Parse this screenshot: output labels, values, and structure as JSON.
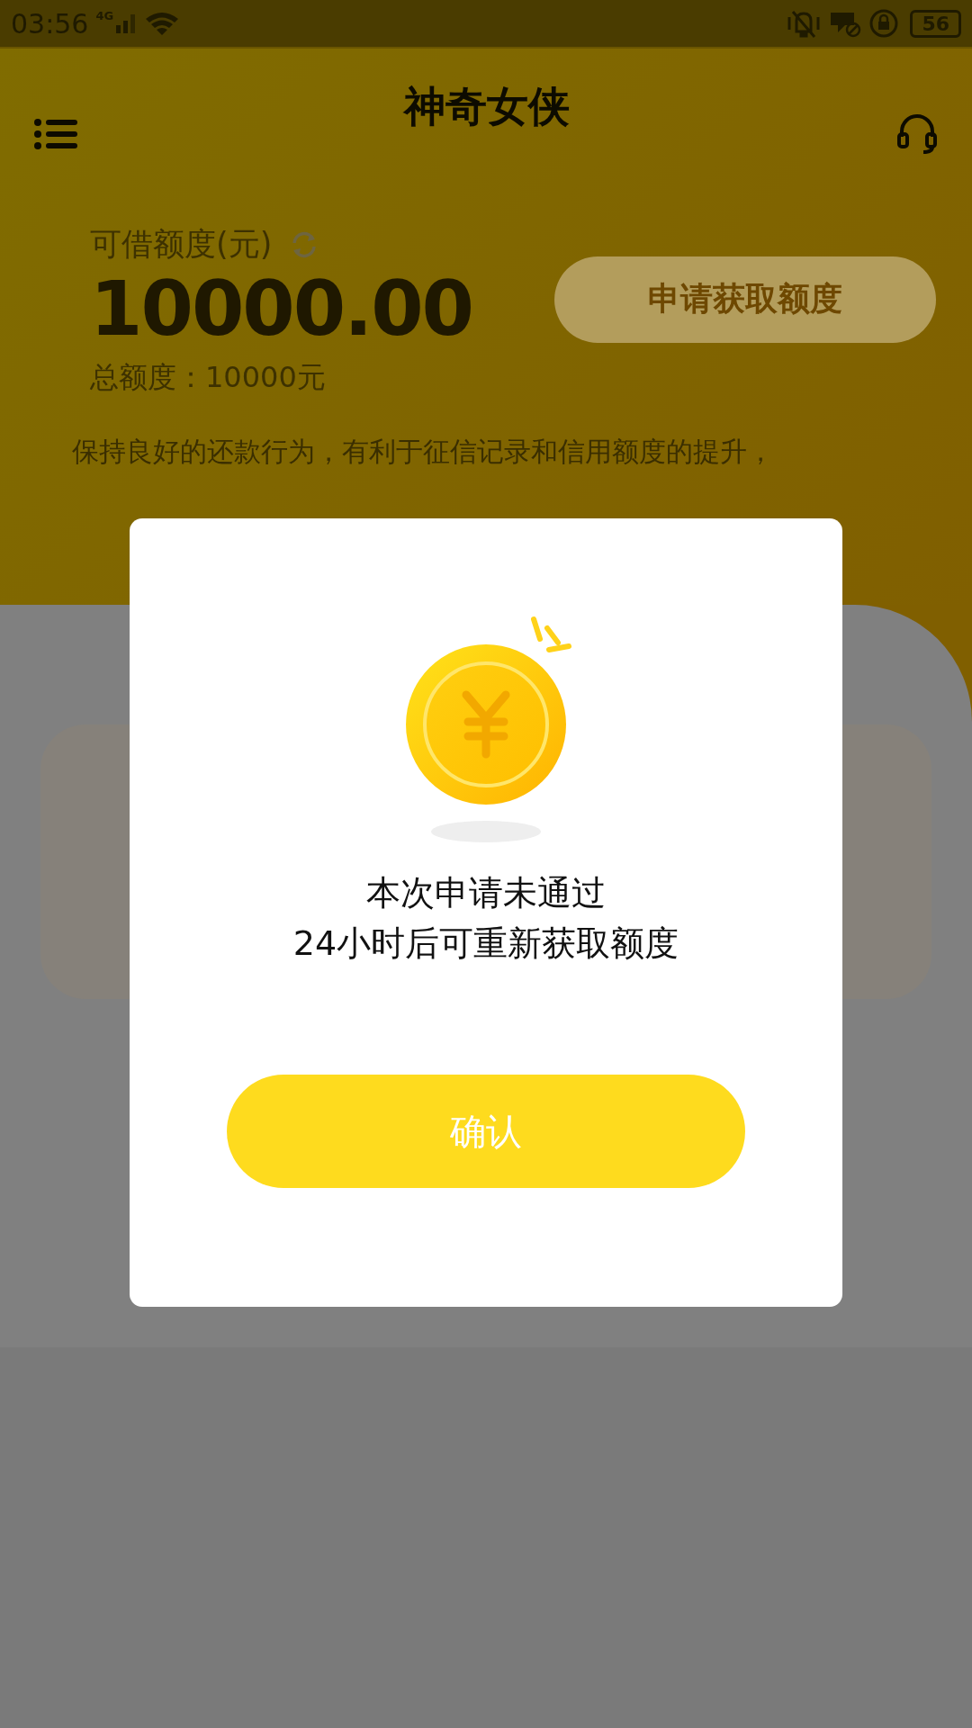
{
  "status_bar": {
    "time": "03:56",
    "network": "4G",
    "battery": "56"
  },
  "header": {
    "title": "神奇女侠"
  },
  "credit": {
    "label": "可借额度(元)",
    "amount": "10000.00",
    "apply_button": "申请获取额度",
    "total": "总额度：10000元",
    "tip": "保持良好的还款行为，有利于征信记录和信用额度的提升，"
  },
  "dialog": {
    "message_lines": [
      "本次申请未通过",
      "24小时后可重新获取额度"
    ],
    "confirm_button": "确认"
  }
}
